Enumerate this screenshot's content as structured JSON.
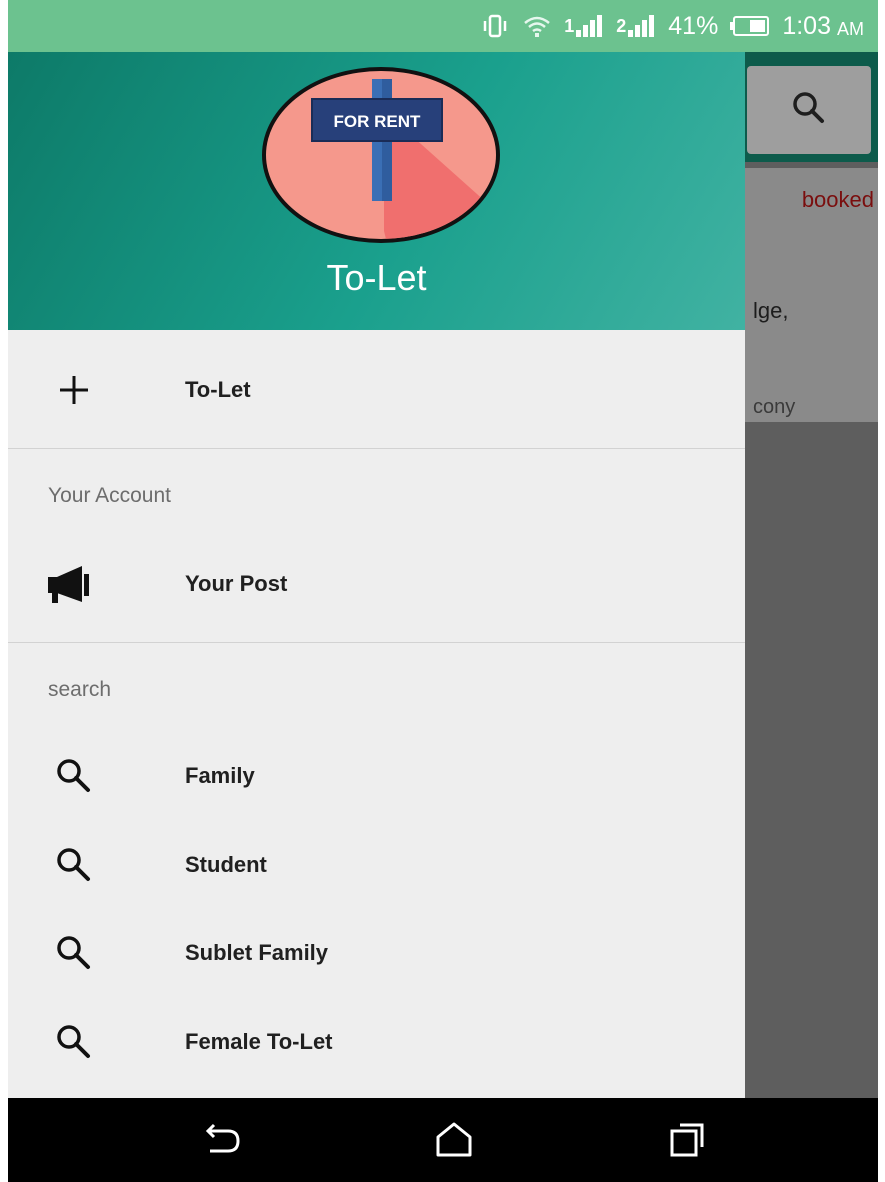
{
  "status_bar": {
    "battery": "41%",
    "time": "1:03",
    "ampm": "AM",
    "sim1": "1",
    "sim2": "2"
  },
  "background_app": {
    "status_text": "booked",
    "text_line1": "lge,",
    "text_line2": "cony"
  },
  "drawer": {
    "header": {
      "logo_text": "FOR RENT",
      "title": "To-Let"
    },
    "items": [
      {
        "label": "To-Let",
        "icon": "plus-icon"
      }
    ],
    "account_section": {
      "header": "Your Account",
      "items": [
        {
          "label": "Your Post",
          "icon": "megaphone-icon"
        }
      ]
    },
    "search_section": {
      "header": "search",
      "items": [
        {
          "label": "Family",
          "icon": "search-icon"
        },
        {
          "label": "Student",
          "icon": "search-icon"
        },
        {
          "label": "Sublet Family",
          "icon": "search-icon"
        },
        {
          "label": "Female To-Let",
          "icon": "search-icon"
        }
      ]
    }
  },
  "colors": {
    "header_gradient_start": "#0d7a68",
    "header_gradient_end": "#41b2a2",
    "status_bar": "#6cc28f",
    "logo_background": "#f5988c",
    "sign_board": "#27407a"
  },
  "nav_bar": {
    "back": "back-icon",
    "home": "home-icon",
    "recents": "recents-icon"
  }
}
